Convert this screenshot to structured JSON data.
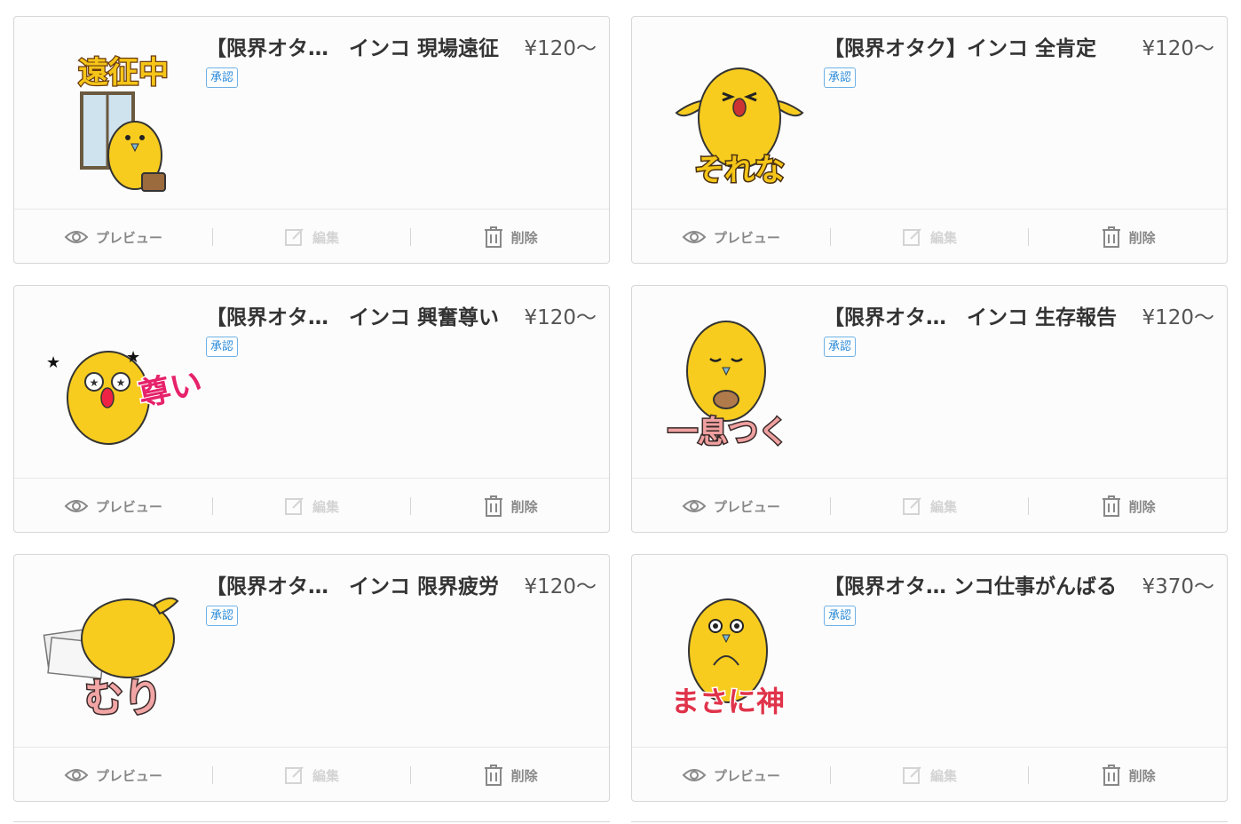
{
  "cards": [
    {
      "title": "【限界オタ…　インコ 現場遠征",
      "price": "¥120〜",
      "status": "承認",
      "sticker_text": "遠征中",
      "sticker_icon": "parakeet-travel-sticker"
    },
    {
      "title": "【限界オタク】インコ 全肯定",
      "price": "¥120〜",
      "status": "承認",
      "sticker_text": "それな",
      "sticker_icon": "parakeet-agree-sticker"
    },
    {
      "title": "【限界オタ…　インコ 興奮尊い",
      "price": "¥120〜",
      "status": "承認",
      "sticker_text": "尊い",
      "sticker_icon": "parakeet-excited-sticker"
    },
    {
      "title": "【限界オタ…　インコ 生存報告",
      "price": "¥120〜",
      "status": "承認",
      "sticker_text": "一息つく",
      "sticker_icon": "parakeet-tea-sticker"
    },
    {
      "title": "【限界オタ…　インコ 限界疲労",
      "price": "¥120〜",
      "status": "承認",
      "sticker_text": "むり",
      "sticker_icon": "parakeet-tired-sticker"
    },
    {
      "title": "【限界オタ… ンコ仕事がんばる",
      "price": "¥370〜",
      "status": "承認",
      "sticker_text": "まさに神",
      "sticker_icon": "parakeet-pray-sticker"
    }
  ],
  "actions": {
    "preview": "プレビュー",
    "edit": "編集",
    "delete": "削除"
  },
  "colors": {
    "badge": "#2a8ad8",
    "parakeet": "#f7cc1e",
    "sticker_red": "#e0334a",
    "sticker_pink": "#e6226a"
  }
}
